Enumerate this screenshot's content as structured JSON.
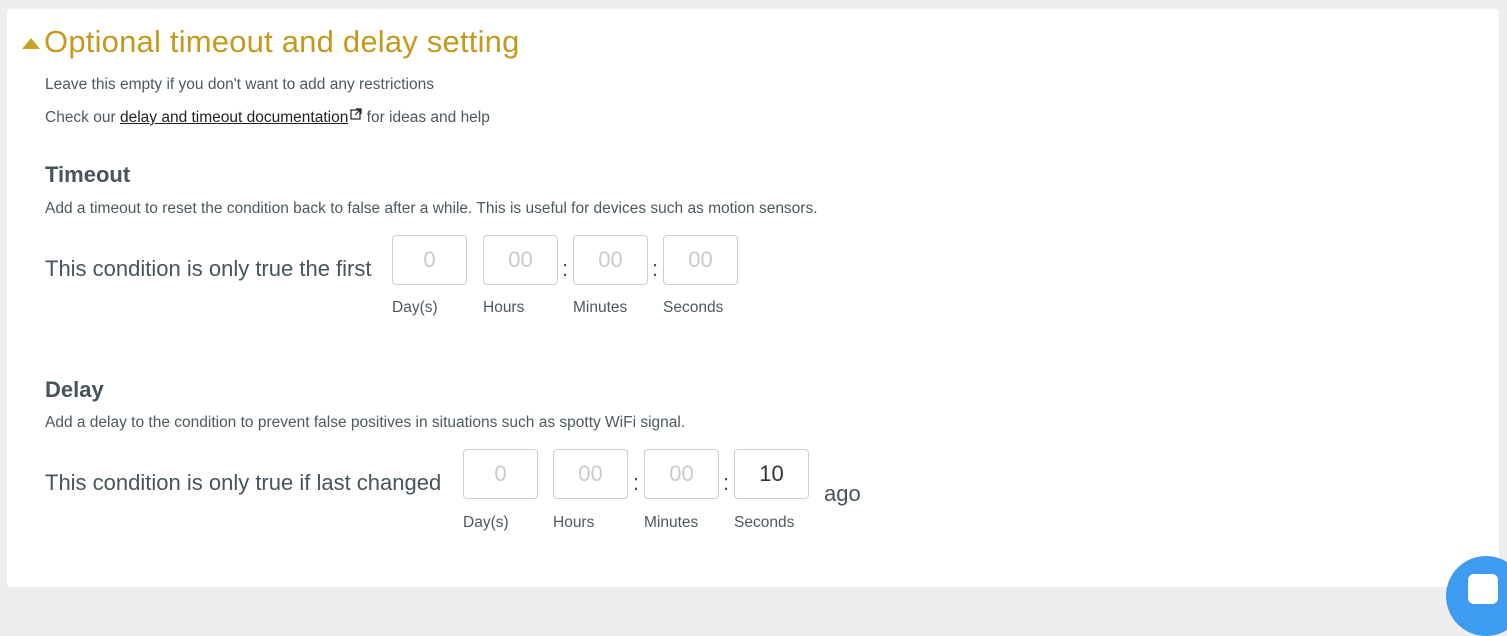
{
  "section": {
    "title": "Optional timeout and delay setting",
    "intro": "Leave this empty if you don't want to add any restrictions",
    "check_prefix": "Check our",
    "doc_link": "delay and timeout documentation",
    "check_suffix": "for ideas and help"
  },
  "timeout": {
    "heading": "Timeout",
    "description": "Add a timeout to reset the condition back to false after a while. This is useful for devices such as motion sensors.",
    "label": "This condition is only true the first",
    "days": {
      "value": "",
      "placeholder": "0",
      "unit": "Day(s)"
    },
    "hours": {
      "value": "",
      "placeholder": "00",
      "unit": "Hours"
    },
    "minutes": {
      "value": "",
      "placeholder": "00",
      "unit": "Minutes"
    },
    "seconds": {
      "value": "",
      "placeholder": "00",
      "unit": "Seconds"
    }
  },
  "delay": {
    "heading": "Delay",
    "description": "Add a delay to the condition to prevent false positives in situations such as spotty WiFi signal.",
    "label": "This condition is only true if last changed",
    "days": {
      "value": "",
      "placeholder": "0",
      "unit": "Day(s)"
    },
    "hours": {
      "value": "",
      "placeholder": "00",
      "unit": "Hours"
    },
    "minutes": {
      "value": "",
      "placeholder": "00",
      "unit": "Minutes"
    },
    "seconds": {
      "value": "10",
      "placeholder": "00",
      "unit": "Seconds"
    },
    "suffix": "ago"
  },
  "separator": ":",
  "colors": {
    "accent": "#c49a1e",
    "fab": "#3d9bf0"
  },
  "icons": {
    "caret": "caret-up-icon",
    "external": "external-link-icon",
    "fab": "chat-icon"
  }
}
